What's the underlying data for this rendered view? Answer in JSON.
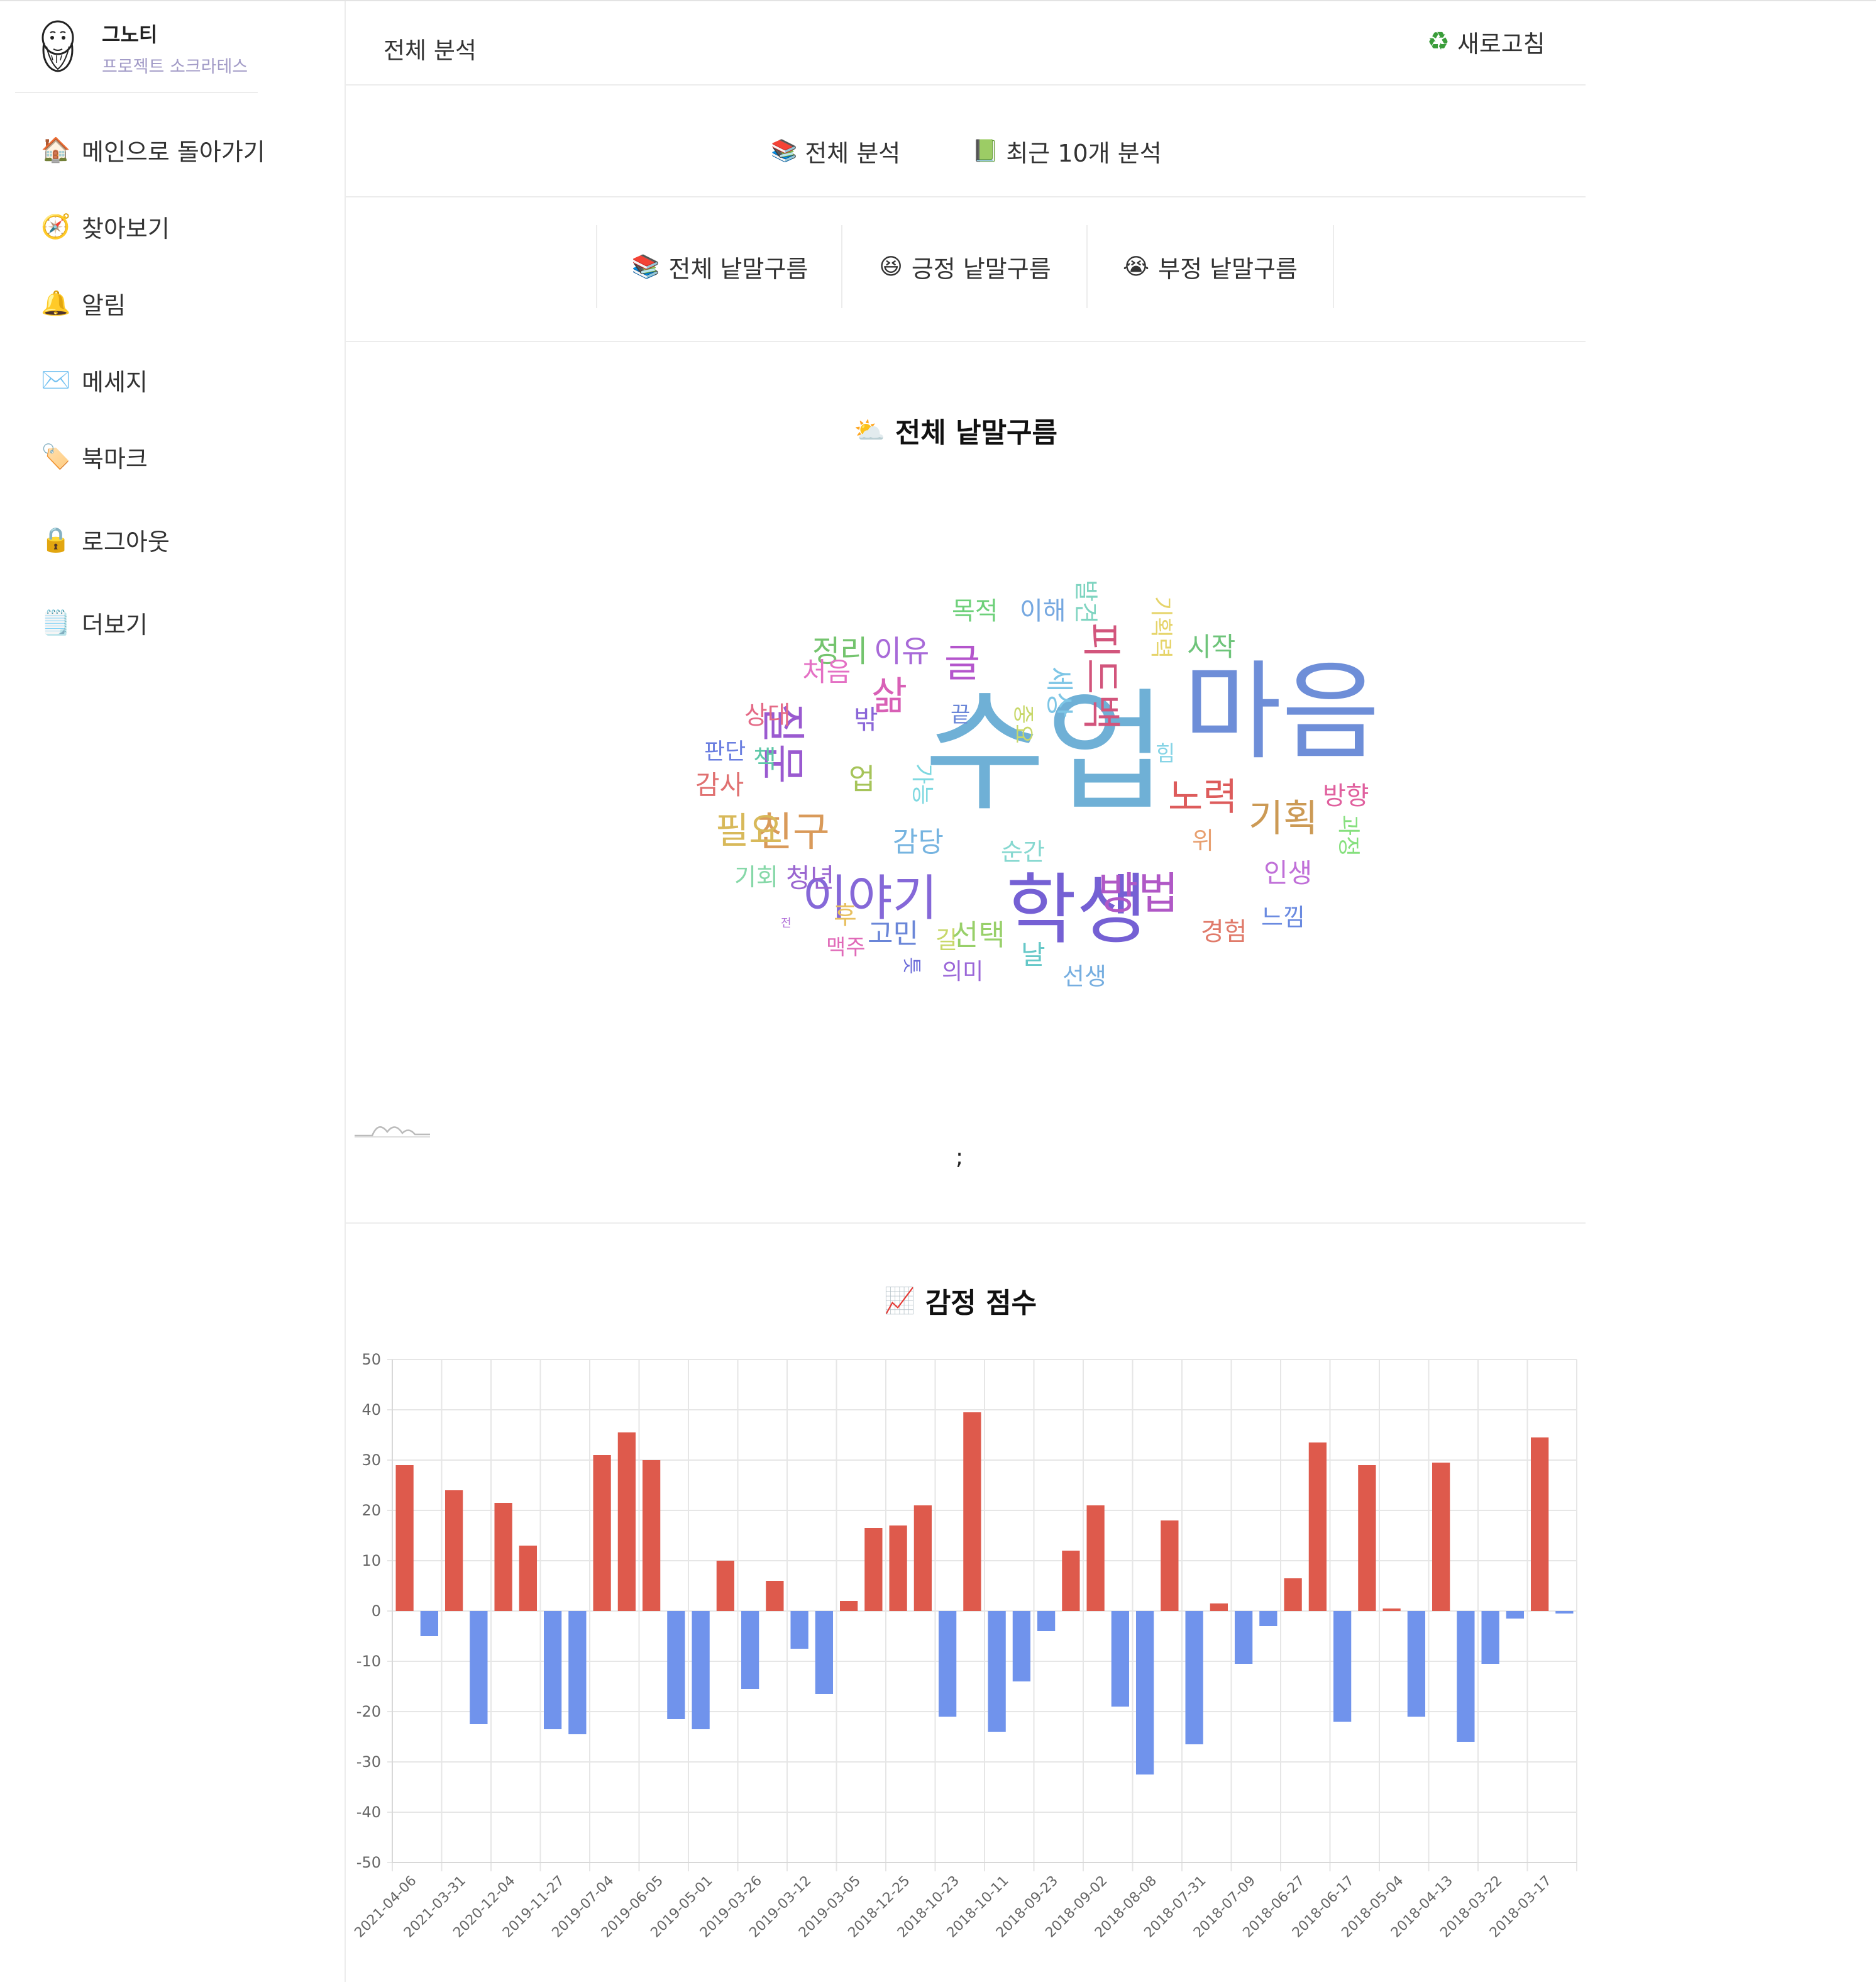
{
  "sidebar": {
    "brand_name": "그노티",
    "brand_sub": "프로젝트 소크라테스",
    "items": [
      {
        "icon": "house-icon",
        "glyph": "🏠",
        "label": "메인으로 돌아가기"
      },
      {
        "icon": "compass-icon",
        "glyph": "🧭",
        "label": "찾아보기"
      },
      {
        "icon": "bell-icon",
        "glyph": "🔔",
        "label": "알림"
      },
      {
        "icon": "envelope-icon",
        "glyph": "✉️",
        "label": "메세지"
      },
      {
        "icon": "bookmark-tag-icon",
        "glyph": "🏷️",
        "label": "북마크"
      },
      {
        "icon": "lock-icon",
        "glyph": "🔒",
        "label": "로그아웃"
      },
      {
        "icon": "notepad-icon",
        "glyph": "🗒️",
        "label": "더보기"
      }
    ]
  },
  "header": {
    "title": "전체 분석",
    "refresh_icon": "recycle-icon",
    "refresh_glyph": "♻",
    "refresh_label": "새로고침"
  },
  "analysis_tabs": [
    {
      "icon": "books-icon",
      "glyph": "📚",
      "label": "전체 분석"
    },
    {
      "icon": "green-book-icon",
      "glyph": "📗",
      "label": "최근 10개 분석"
    }
  ],
  "cloud_tabs": [
    {
      "icon": "books-icon",
      "glyph": "📚",
      "label": "전체 낱말구름"
    },
    {
      "icon": "laughing-face-icon",
      "glyph": "😆",
      "label": "긍정 낱말구름"
    },
    {
      "icon": "crying-face-icon",
      "glyph": "😭",
      "label": "부정 낱말구름"
    }
  ],
  "wordcloud": {
    "title_icon": "sun-behind-cloud-icon",
    "title_glyph": "⛅",
    "title": "전체 낱말구름",
    "semicolon": ";",
    "words": [
      {
        "text": "수업",
        "size": 210,
        "color": "#6fb0d6"
      },
      {
        "text": "마음",
        "size": 170,
        "color": "#6e8ed8"
      },
      {
        "text": "학생",
        "size": 122,
        "color": "#7560d4"
      },
      {
        "text": "이야기",
        "size": 78,
        "color": "#8568d8"
      },
      {
        "text": "질문",
        "size": 70,
        "color": "#9a5ad0"
      },
      {
        "text": "피드백",
        "size": 62,
        "color": "#d2557c"
      },
      {
        "text": "방법",
        "size": 70,
        "color": "#b058c6"
      },
      {
        "text": "친구",
        "size": 64,
        "color": "#d99a5a"
      },
      {
        "text": "노력",
        "size": 60,
        "color": "#dd5c5c"
      },
      {
        "text": "기획",
        "size": 60,
        "color": "#cc9a55"
      },
      {
        "text": "필요",
        "size": 58,
        "color": "#d8b95a"
      },
      {
        "text": "삶",
        "size": 62,
        "color": "#d860b6"
      },
      {
        "text": "글",
        "size": 62,
        "color": "#b455cc"
      },
      {
        "text": "정리",
        "size": 48,
        "color": "#74c46e"
      },
      {
        "text": "이유",
        "size": 48,
        "color": "#a86ad8"
      },
      {
        "text": "세상",
        "size": 44,
        "color": "#7ec6e6"
      },
      {
        "text": "시작",
        "size": 42,
        "color": "#6ec47a"
      },
      {
        "text": "목적",
        "size": 40,
        "color": "#6ed07a"
      },
      {
        "text": "이해",
        "size": 40,
        "color": "#76a8e0"
      },
      {
        "text": "발견",
        "size": 38,
        "color": "#7ed4c0"
      },
      {
        "text": "기획력",
        "size": 36,
        "color": "#e6d46a"
      },
      {
        "text": "처음",
        "size": 42,
        "color": "#e470c4"
      },
      {
        "text": "상대",
        "size": 40,
        "color": "#e46a86"
      },
      {
        "text": "밖",
        "size": 42,
        "color": "#8a66d8"
      },
      {
        "text": "끝",
        "size": 34,
        "color": "#6a86d8"
      },
      {
        "text": "중요",
        "size": 34,
        "color": "#c8d86a"
      },
      {
        "text": "힘",
        "size": 34,
        "color": "#86d4e6"
      },
      {
        "text": "판단",
        "size": 36,
        "color": "#6a7ee0"
      },
      {
        "text": "책",
        "size": 40,
        "color": "#5ec8a8"
      },
      {
        "text": "업",
        "size": 46,
        "color": "#a6c45a"
      },
      {
        "text": "가능",
        "size": 36,
        "color": "#7ed8e0"
      },
      {
        "text": "감사",
        "size": 42,
        "color": "#e07070"
      },
      {
        "text": "방향",
        "size": 40,
        "color": "#e0609e"
      },
      {
        "text": "과정",
        "size": 36,
        "color": "#86e07e"
      },
      {
        "text": "감당",
        "size": 44,
        "color": "#76b4e0"
      },
      {
        "text": "위",
        "size": 38,
        "color": "#e8a070"
      },
      {
        "text": "순간",
        "size": 38,
        "color": "#86d8d0"
      },
      {
        "text": "인생",
        "size": 42,
        "color": "#c070d8"
      },
      {
        "text": "기회",
        "size": 38,
        "color": "#86d8a8"
      },
      {
        "text": "청년",
        "size": 42,
        "color": "#9a66d0"
      },
      {
        "text": "후",
        "size": 40,
        "color": "#e8c060"
      },
      {
        "text": "고민",
        "size": 44,
        "color": "#6a86d8"
      },
      {
        "text": "길",
        "size": 38,
        "color": "#c8d86a"
      },
      {
        "text": "선택",
        "size": 46,
        "color": "#98d06a"
      },
      {
        "text": "경험",
        "size": 40,
        "color": "#e07a6a"
      },
      {
        "text": "느낌",
        "size": 38,
        "color": "#6a8ae0"
      },
      {
        "text": "전",
        "size": 18,
        "color": "#b070d8"
      },
      {
        "text": "맥주",
        "size": 34,
        "color": "#e06ab8"
      },
      {
        "text": "날",
        "size": 42,
        "color": "#66c8c8"
      },
      {
        "text": "의미",
        "size": 36,
        "color": "#9a66d8"
      },
      {
        "text": "선생",
        "size": 38,
        "color": "#76aee0"
      },
      {
        "text": "틋",
        "size": 30,
        "color": "#6a6ad8"
      }
    ]
  },
  "sentiment": {
    "title_icon": "chart-increasing-icon",
    "title_glyph": "📈",
    "title": "감정 점수"
  },
  "chart_data": {
    "type": "bar",
    "title": "감정 점수",
    "ylim": [
      -50,
      50
    ],
    "yticks": [
      50,
      40,
      30,
      20,
      10,
      0,
      -10,
      -20,
      -30,
      -40,
      -50
    ],
    "grid": true,
    "positive_color": "#de5a4c",
    "negative_color": "#7093ec",
    "x_tick_labels": [
      "2021-04-06",
      "2021-03-31",
      "2020-12-04",
      "2019-11-27",
      "2019-07-04",
      "2019-06-05",
      "2019-05-01",
      "2019-03-26",
      "2019-03-12",
      "2019-03-05",
      "2018-12-25",
      "2018-10-23",
      "2018-10-11",
      "2018-09-23",
      "2018-09-02",
      "2018-08-08",
      "2018-07-31",
      "2018-07-09",
      "2018-06-27",
      "2018-06-17",
      "2018-05-04",
      "2018-04-13",
      "2018-03-22",
      "2018-03-17"
    ],
    "values": [
      29,
      -5,
      24,
      -22.5,
      21.5,
      13,
      -23.5,
      -24.5,
      31,
      35.5,
      30,
      -21.5,
      -23.5,
      10,
      -15.5,
      6,
      -7.5,
      -16.5,
      2,
      16.5,
      17,
      21,
      -21,
      39.5,
      -24,
      -14,
      -4,
      12,
      21,
      -19,
      -32.5,
      18,
      -26.5,
      1.5,
      -10.5,
      -3,
      6.5,
      33.5,
      -22,
      29,
      0.5,
      -21,
      29.5,
      -26,
      -10.5,
      -1.5,
      34.5,
      -0.5
    ]
  }
}
